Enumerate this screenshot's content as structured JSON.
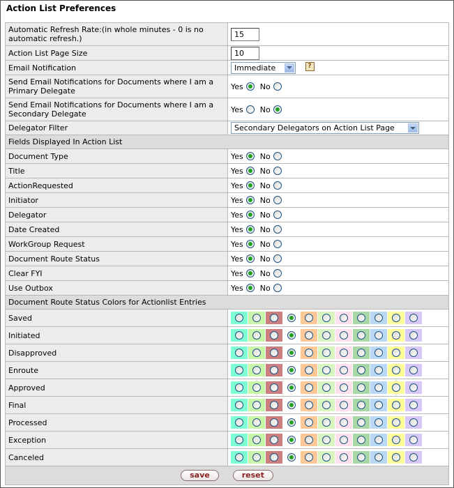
{
  "page": {
    "title": "Action List Preferences"
  },
  "settings": {
    "refresh": {
      "label": "Automatic Refresh Rate:(in whole minutes - 0 is no automatic refresh.)",
      "value": "15"
    },
    "page_size": {
      "label": "Action List Page Size",
      "value": "10"
    },
    "email": {
      "label": "Email Notification",
      "value": "Immediate",
      "help_glyph": "?"
    },
    "primary_delegate": {
      "label": "Send Email Notifications for Documents where I am a Primary Delegate",
      "selected": "Yes"
    },
    "secondary_delegate": {
      "label": "Send Email Notifications for Documents where I am a Secondary Delegate",
      "selected": "No"
    },
    "delegator_filter": {
      "label": "Delegator Filter",
      "value": "Secondary Delegators on Action List Page"
    }
  },
  "yes_label": "Yes",
  "no_label": "No",
  "fields_section": {
    "title": "Fields Displayed In Action List"
  },
  "fields": [
    {
      "label": "Document Type",
      "selected": "Yes"
    },
    {
      "label": "Title",
      "selected": "Yes"
    },
    {
      "label": "ActionRequested",
      "selected": "Yes"
    },
    {
      "label": "Initiator",
      "selected": "Yes"
    },
    {
      "label": "Delegator",
      "selected": "Yes"
    },
    {
      "label": "Date Created",
      "selected": "Yes"
    },
    {
      "label": "WorkGroup Request",
      "selected": "Yes"
    },
    {
      "label": "Document Route Status",
      "selected": "Yes"
    },
    {
      "label": "Clear FYI",
      "selected": "Yes"
    },
    {
      "label": "Use Outbox",
      "selected": "Yes"
    }
  ],
  "colors_section": {
    "title": "Document Route Status Colors for Actionlist Entries",
    "palette": [
      "#7fffd4",
      "#c8f7a8",
      "#cd7f7f",
      "#ffffff",
      "#ffc896",
      "#d8f5c0",
      "#ffe0ec",
      "#a8d8a8",
      "#b9d8f5",
      "#ffff99",
      "#d8c8f8"
    ],
    "selected_index": 3
  },
  "statuses": [
    {
      "label": "Saved"
    },
    {
      "label": "Initiated"
    },
    {
      "label": "Disapproved"
    },
    {
      "label": "Enroute"
    },
    {
      "label": "Approved"
    },
    {
      "label": "Final"
    },
    {
      "label": "Processed"
    },
    {
      "label": "Exception"
    },
    {
      "label": "Canceled"
    }
  ],
  "buttons": {
    "save": "save",
    "reset": "reset"
  }
}
